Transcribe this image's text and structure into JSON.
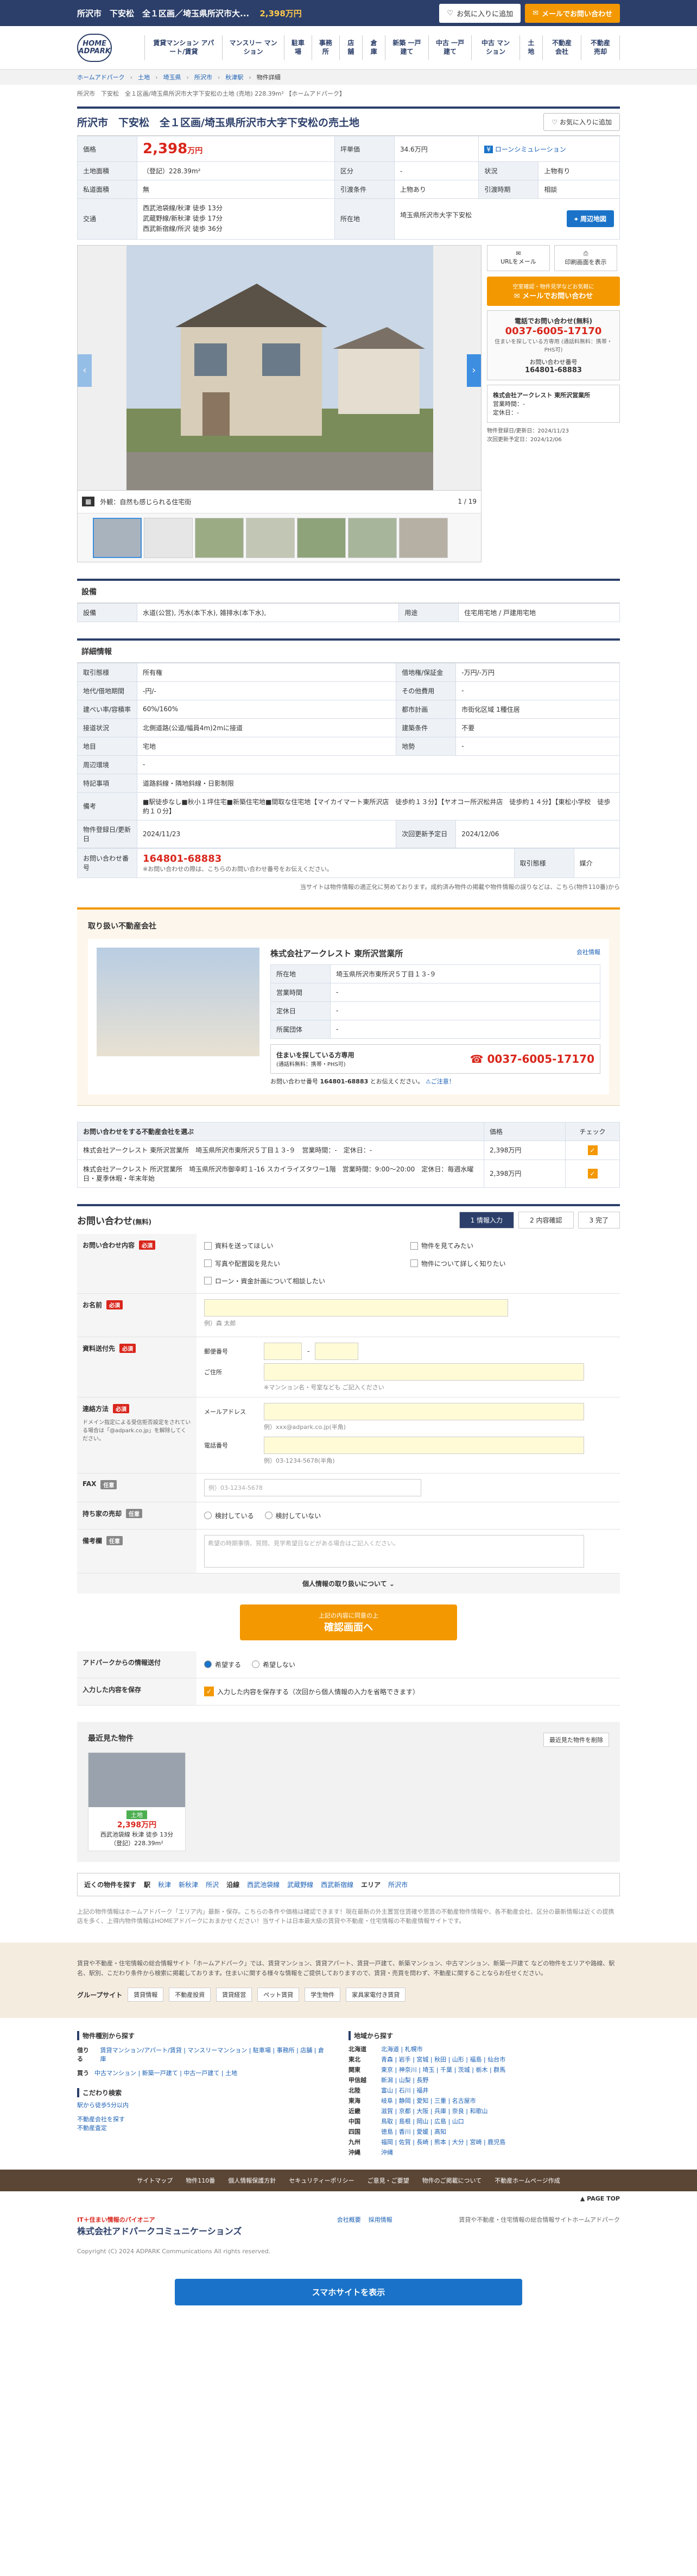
{
  "topbar": {
    "title": "所沢市　下安松　全１区画／埼玉県所沢市大...",
    "price": "2,398万円",
    "fav": "お気に入りに追加",
    "mail": "メールでお問い合わせ"
  },
  "logo": "HOME ADPARK",
  "gnav": [
    "賃貸マンション アパート/賃貸",
    "マンスリー マンション",
    "駐車場",
    "事務所",
    "店舗",
    "倉庫",
    "新築 一戸建て",
    "中古 一戸建て",
    "中古 マンション",
    "土地",
    "不動産 会社",
    "不動産 売却"
  ],
  "breadcrumb": [
    "ホームアドパーク",
    "土地",
    "埼玉県",
    "所沢市",
    "秋津駅",
    "物件詳細"
  ],
  "subline": "所沢市　下安松　全１区画/埼玉県所沢市大字下安松の土地 (売地) 228.39m² 【ホームアドパーク】",
  "title": "所沢市　下安松　全１区画/埼玉県所沢市大字下安松の売土地",
  "fav2": "お気に入りに追加",
  "spec": {
    "price_label": "価格",
    "price": "2,398",
    "price_unit": "万円",
    "tsubo_label": "坪単価",
    "tsubo": "34.6万円",
    "loan": "ローンシミュレーション",
    "area_label": "土地面積",
    "area": "（登記）228.39m²",
    "kubun_label": "区分",
    "kubun": "-",
    "jokyo_label": "状況",
    "jokyo": "上物有り",
    "shakuchi_label": "私道面積",
    "shakuchi": "無",
    "hikiwatashi_label": "引渡条件",
    "hikiwatashi": "上物あり",
    "hikiwatashi2_label": "引渡時期",
    "hikiwatashi2": "相談",
    "kotsu_label": "交通",
    "kotsu1": "西武池袋線/秋津 徒歩 13分",
    "kotsu2": "武蔵野線/新秋津 徒歩 17分",
    "kotsu3": "西武新宿線/所沢 徒歩 36分",
    "addr_label": "所在地",
    "addr": "埼玉県所沢市大字下安松",
    "map": "周辺地図"
  },
  "gallery": {
    "caption_label": "外観：",
    "caption": "外観：自然も感じられる住宅街",
    "counter": "1 / 19"
  },
  "side": {
    "url_mail": "URLをメール",
    "print": "印刷画面を表示",
    "cta_small": "空室確認・物件見学などお気軽に",
    "cta": "メールでお問い合わせ",
    "tel_title": "電話でお問い合わせ(無料)",
    "tel": "0037-6005-17170",
    "tel_note": "住まいを探している方専用 (通話料無料：携帯・PHS可)",
    "inq_label": "お問い合わせ番号",
    "inq_no": "164801-68883",
    "company": "株式会社アークレスト 東所沢営業所",
    "office_time_label": "営業時間",
    "office_time": "-",
    "holiday_label": "定休日",
    "holiday": "-",
    "reg_label": "物件登録日/更新日",
    "reg": "2024/11/23",
    "next_label": "次回更新予定日",
    "next": "2024/12/06"
  },
  "setsubi": {
    "heading": "設備",
    "label": "設備",
    "value": "水道(公営), 汚水(本下水), 雑排水(本下水),",
    "use_label": "用途",
    "use_value": "住宅用宅地 / 戸建用宅地"
  },
  "detail": {
    "heading": "詳細情報",
    "rows": [
      [
        "取引態様",
        "所有権",
        "借地権/保証金",
        "-万円/-万円"
      ],
      [
        "地代/借地期間",
        "-円/-",
        "その他費用",
        "-"
      ],
      [
        "建ぺい率/容積率",
        "60%/160%",
        "都市計画",
        "市街化区域 1種住居"
      ],
      [
        "接道状況",
        "北側道路(公道/幅員4m)2mに接道",
        "建築条件",
        "不要"
      ],
      [
        "地目",
        "宅地",
        "地勢",
        "-"
      ],
      [
        "周辺環境",
        "-",
        "",
        ""
      ],
      [
        "特記事項",
        "道路斜線・隣地斜線・日影制限",
        "",
        ""
      ],
      [
        "備考",
        "■駅徒歩なし■秋小１坪住宅■新築住宅地■間取な住宅地【マイカイマート東所沢店　徒歩約１３分】【ヤオコー所沢松井店　徒歩約１４分】【東松小学校　徒歩約１０分】",
        "",
        ""
      ],
      [
        "物件登録日/更新日",
        "2024/11/23",
        "次回更新予定日",
        "2024/12/06"
      ]
    ],
    "inq_label": "お問い合わせ番号",
    "inq_no": "164801-68883",
    "inq_note": "※お問い合わせの際は、こちらのお問い合わせ番号をお伝えください。",
    "torihiki_label": "取引態様",
    "torihiki": "媒介",
    "notice": "当サイトは物件情報の適正化に努めております。成約済み物件の掲載や物件情報の誤りなどは、こちら(物件110番)から"
  },
  "company": {
    "heading": "取り扱い不動産会社",
    "name": "株式会社アークレスト 東所沢営業所",
    "info_link": "会社情報",
    "addr_label": "所在地",
    "addr": "埼玉県所沢市東所沢５丁目１３-９",
    "time_label": "営業時間",
    "time": "-",
    "holiday_label": "定休日",
    "holiday": "-",
    "group_label": "所属団体",
    "group": "-",
    "tel_title": "住まいを探している方専用",
    "tel_note": "(通話料無料：携帯・PHS可)",
    "tel": "0037-6005-17170",
    "inq": "お問い合わせ番号",
    "inq_no": "164801-68883",
    "inq_tail": "とお伝えください。",
    "caution": "ご注意！"
  },
  "choose": {
    "heading": "お問い合わせをする不動産会社を選ぶ",
    "price_col": "価格",
    "check_col": "チェック",
    "rows": [
      [
        "株式会社アークレスト 東所沢営業所　埼玉県所沢市東所沢５丁目１３-９　営業時間：-　定休日：-",
        "2,398万円"
      ],
      [
        "株式会社アークレスト 所沢営業所　埼玉県所沢市御幸町１-16 スカイライズタワー1階　営業時間：9:00〜20:00　定休日：毎週水曜日・夏季休暇・年末年始",
        "2,398万円"
      ]
    ]
  },
  "form": {
    "heading": "お問い合わせ",
    "heading_small": "(無料)",
    "steps": [
      "情報入力",
      "内容確認",
      "完了"
    ],
    "content_label": "お問い合わせ内容",
    "req": "必須",
    "opt": "任意",
    "contents": [
      "資料を送ってほしい",
      "物件を見てみたい",
      "写真や配置図を見たい",
      "物件について詳しく知りたい",
      "ローン・資金計画について相談したい"
    ],
    "name_label": "お名前",
    "name_ph": "例）森 太郎",
    "addr_label": "資料送付先",
    "zip_label": "郵便番号",
    "addr2_label": "ご住所",
    "addr_note": "※マンション名・号室なども ご記入ください",
    "contact_label": "連絡方法",
    "contact_note": "ドメイン指定による受信拒否設定をされている場合は「@adpark.co.jp」を解除してください。",
    "mail_label": "メールアドレス",
    "mail_ph": "例）xxx@adpark.co.jp(半角)",
    "tel_label": "電話番号",
    "tel_ph": "例）03-1234-5678(半角)",
    "fax_label": "FAX",
    "fax_ph": "例）03-1234-5678",
    "land_label": "持ち家の売却",
    "land_a": "検討している",
    "land_b": "検討していない",
    "memo_label": "備考欄",
    "memo_ph": "希望の時期事情、質問、見学希望日などがある場合はご記入ください。",
    "privacy": "個人情報の取り扱いについて",
    "submit_small": "上記の内容に同意の上",
    "submit": "確認画面へ",
    "news_label": "アドパークからの情報送付",
    "news_a": "希望する",
    "news_b": "希望しない",
    "save_label": "入力した内容を保存",
    "save_text": "入力した内容を保存する（次回から個人情報の入力を省略できます）"
  },
  "recent": {
    "heading": "最近見た物件",
    "clear": "最近見た物件を削除",
    "tag": "土地",
    "price": "2,398万円",
    "line1": "西武池袋線 秋津 徒歩 13分",
    "line2": "（登記）228.39m²"
  },
  "quick": {
    "label": "近くの物件を探す",
    "items": [
      "駅",
      "秋津",
      "新秋津",
      "所沢",
      "沿線",
      "西武池袋線",
      "武蔵野線",
      "西武新宿線",
      "エリア",
      "所沢市"
    ]
  },
  "footnote": "上記の物件情報はホームアドパーク「エリア内」最新・保存。こちらの条件や価格は確認できます！現在最新の外主置営住賃確や思賃の不動産物件情報や、各不動産会社、区分の最新情報は近くの提携店を多く、上得内物件情報はHOMEアドパークにおまかせください！当サイトは日本最大級の賃貸や不動産・住宅情報の不動産情報サイトです。",
  "footer1": {
    "text": "賃貸や不動産・住宅情報の総合情報サイト「ホームアドパーク」では、賃貸マンション、賃貸アパート、賃貸一戸建て、新築マンション、中古マンション、新築一戸建て などの物件をエリアや路線、駅名、駅別、こだわり条件から検索に掲載しております。住まいに関する様々な情報をご提供しておりますので、賃貸・売買を問わず、不動産に関することならお任せください。",
    "group": "グループサイト",
    "groups": [
      "賃貸情報",
      "不動産投資",
      "賃貸経営",
      "ペット賃貸",
      "学生物件",
      "家具家電付き賃貸"
    ]
  },
  "footer2": {
    "search_title": "物件種別から探す",
    "rent": "借りる",
    "rent_items": "賃貸マンション/アパート/賃貸 | マンスリーマンション | 駐車場 | 事務所 | 店舗 | 倉庫",
    "buy": "買う",
    "buy_items": "中古マンション | 新築一戸建て | 中古一戸建て | 土地",
    "kodawari_title": "こだわり検索",
    "kodawari": "駅から徒歩5分以内",
    "realtor1": "不動産会社を探す",
    "realtor2": "不動産査定",
    "area_title": "地域から探す",
    "areas": [
      [
        "北海道",
        "北海道 | 札幌市"
      ],
      [
        "東北",
        "青森 | 岩手 | 宮城 | 秋田 | 山形 | 福島 | 仙台市"
      ],
      [
        "関東",
        "東京 | 神奈川 | 埼玉 | 千葉 | 茨城 | 栃木 | 群馬"
      ],
      [
        "甲信越",
        "新潟 | 山梨 | 長野"
      ],
      [
        "北陸",
        "富山 | 石川 | 福井"
      ],
      [
        "東海",
        "岐阜 | 静岡 | 愛知 | 三重 | 名古屋市"
      ],
      [
        "近畿",
        "滋賀 | 京都 | 大阪 | 兵庫 | 奈良 | 和歌山"
      ],
      [
        "中国",
        "鳥取 | 島根 | 岡山 | 広島 | 山口"
      ],
      [
        "四国",
        "徳島 | 香川 | 愛媛 | 高知"
      ],
      [
        "九州",
        "福岡 | 佐賀 | 長崎 | 熊本 | 大分 | 宮崎 | 鹿児島"
      ],
      [
        "沖縄",
        "沖縄"
      ]
    ]
  },
  "footer3": [
    "サイトマップ",
    "物件110番",
    "個人情報保護方針",
    "セキュリティーポリシー",
    "ご意見・ご要望",
    "物件のご掲載について",
    "不動産ホームページ作成"
  ],
  "pagetop": "PAGE TOP",
  "footer4": {
    "tag": "IT＋住まい情報のパイオニア",
    "company": "株式会社アドパークコミュニケーションズ",
    "links": [
      "会社概要",
      "採用情報"
    ],
    "right": "賃貸や不動産・住宅情報の総合情報サイトホームアドパーク",
    "copy": "Copyright (C) 2024 ADPARK Communications All rights reserved."
  },
  "sp": "スマホサイトを表示"
}
